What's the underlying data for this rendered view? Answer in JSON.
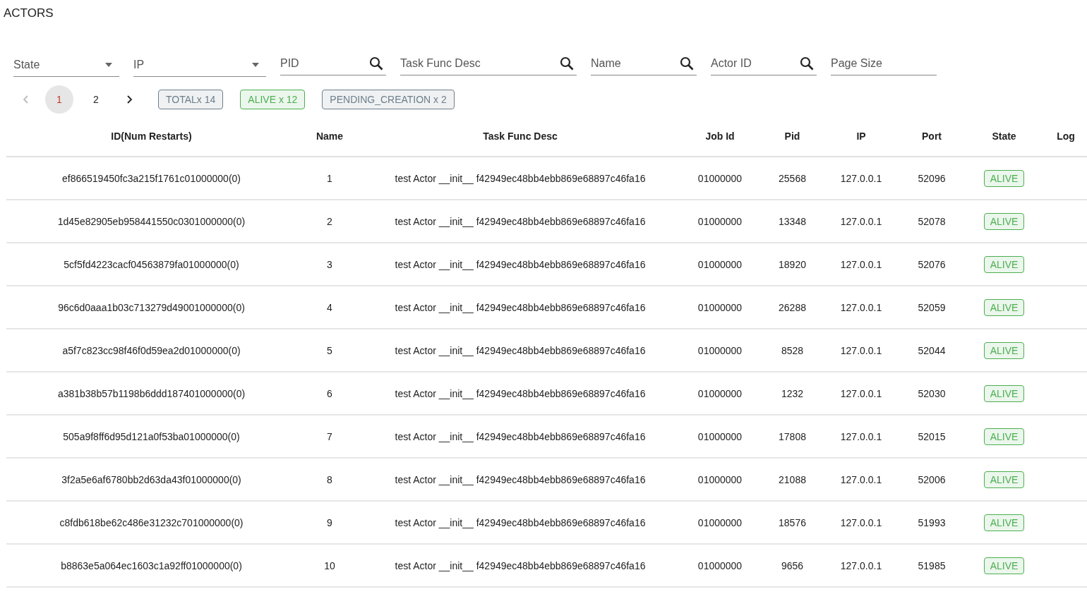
{
  "title": "ACTORS",
  "filters": [
    {
      "kind": "select",
      "placeholder": "State"
    },
    {
      "kind": "select",
      "placeholder": "IP"
    },
    {
      "kind": "search",
      "placeholder": "PID"
    },
    {
      "kind": "search",
      "placeholder": "Task Func Desc"
    },
    {
      "kind": "search",
      "placeholder": "Name"
    },
    {
      "kind": "search",
      "placeholder": "Actor ID"
    },
    {
      "kind": "text",
      "placeholder": "Page Size"
    }
  ],
  "pagination": {
    "prev_disabled": true,
    "next_disabled": false,
    "pages": [
      {
        "label": "1",
        "selected": true
      },
      {
        "label": "2",
        "selected": false
      }
    ]
  },
  "summary_tags": [
    {
      "label": "TOTALx 14",
      "color": "#6d7f8c"
    },
    {
      "label": "ALIVE x 12",
      "color": "#4caf50"
    },
    {
      "label": "PENDING_CREATION x 2",
      "color": "#6d7f8c"
    }
  ],
  "table": {
    "columns": [
      "ID(Num Restarts)",
      "Name",
      "Task Func Desc",
      "Job Id",
      "Pid",
      "IP",
      "Port",
      "State",
      "Log"
    ],
    "rows": [
      {
        "id": "ef866519450fc3a215f1761c01000000(0)",
        "name": "1",
        "task_func_desc": "test Actor __init__ f42949ec48bb4ebb869e68897c46fa16",
        "job_id": "01000000",
        "pid": "25568",
        "ip": "127.0.0.1",
        "port": "52096",
        "state": "ALIVE",
        "color": "#4caf50"
      },
      {
        "id": "1d45e82905eb958441550c0301000000(0)",
        "name": "2",
        "task_func_desc": "test Actor __init__ f42949ec48bb4ebb869e68897c46fa16",
        "job_id": "01000000",
        "pid": "13348",
        "ip": "127.0.0.1",
        "port": "52078",
        "state": "ALIVE",
        "color": "#4caf50"
      },
      {
        "id": "5cf5fd4223cacf04563879fa01000000(0)",
        "name": "3",
        "task_func_desc": "test Actor __init__ f42949ec48bb4ebb869e68897c46fa16",
        "job_id": "01000000",
        "pid": "18920",
        "ip": "127.0.0.1",
        "port": "52076",
        "state": "ALIVE",
        "color": "#4caf50"
      },
      {
        "id": "96c6d0aaa1b03c713279d49001000000(0)",
        "name": "4",
        "task_func_desc": "test Actor __init__ f42949ec48bb4ebb869e68897c46fa16",
        "job_id": "01000000",
        "pid": "26288",
        "ip": "127.0.0.1",
        "port": "52059",
        "state": "ALIVE",
        "color": "#4caf50"
      },
      {
        "id": "a5f7c823cc98f46f0d59ea2d01000000(0)",
        "name": "5",
        "task_func_desc": "test Actor __init__ f42949ec48bb4ebb869e68897c46fa16",
        "job_id": "01000000",
        "pid": "8528",
        "ip": "127.0.0.1",
        "port": "52044",
        "state": "ALIVE",
        "color": "#4caf50"
      },
      {
        "id": "a381b38b57b1198b6ddd187401000000(0)",
        "name": "6",
        "task_func_desc": "test Actor __init__ f42949ec48bb4ebb869e68897c46fa16",
        "job_id": "01000000",
        "pid": "1232",
        "ip": "127.0.0.1",
        "port": "52030",
        "state": "ALIVE",
        "color": "#4caf50"
      },
      {
        "id": "505a9f8ff6d95d121a0f53ba01000000(0)",
        "name": "7",
        "task_func_desc": "test Actor __init__ f42949ec48bb4ebb869e68897c46fa16",
        "job_id": "01000000",
        "pid": "17808",
        "ip": "127.0.0.1",
        "port": "52015",
        "state": "ALIVE",
        "color": "#4caf50"
      },
      {
        "id": "3f2a5e6af6780bb2d63da43f01000000(0)",
        "name": "8",
        "task_func_desc": "test Actor __init__ f42949ec48bb4ebb869e68897c46fa16",
        "job_id": "01000000",
        "pid": "21088",
        "ip": "127.0.0.1",
        "port": "52006",
        "state": "ALIVE",
        "color": "#4caf50"
      },
      {
        "id": "c8fdb618be62c486e31232c701000000(0)",
        "name": "9",
        "task_func_desc": "test Actor __init__ f42949ec48bb4ebb869e68897c46fa16",
        "job_id": "01000000",
        "pid": "18576",
        "ip": "127.0.0.1",
        "port": "51993",
        "state": "ALIVE",
        "color": "#4caf50"
      },
      {
        "id": "b8863e5a064ec1603c1a92ff01000000(0)",
        "name": "10",
        "task_func_desc": "test Actor __init__ f42949ec48bb4ebb869e68897c46fa16",
        "job_id": "01000000",
        "pid": "9656",
        "ip": "127.0.0.1",
        "port": "51985",
        "state": "ALIVE",
        "color": "#4caf50"
      }
    ]
  }
}
